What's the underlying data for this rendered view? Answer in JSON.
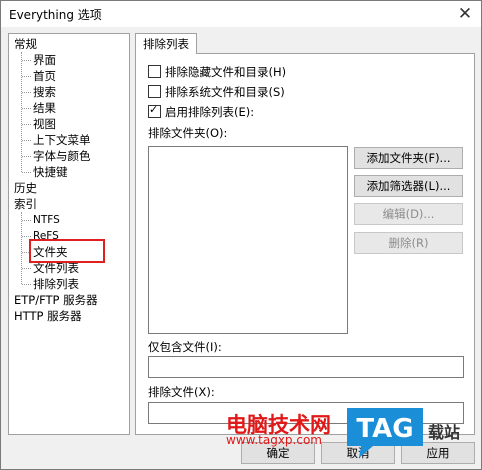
{
  "window": {
    "title": "Everything 选项"
  },
  "tree": {
    "items": [
      {
        "label": "常规"
      },
      {
        "label": "界面"
      },
      {
        "label": "首页"
      },
      {
        "label": "搜索"
      },
      {
        "label": "结果"
      },
      {
        "label": "视图"
      },
      {
        "label": "上下文菜单"
      },
      {
        "label": "字体与颜色"
      },
      {
        "label": "快捷键"
      },
      {
        "label": "历史"
      },
      {
        "label": "索引"
      },
      {
        "label": "NTFS"
      },
      {
        "label": "ReFS"
      },
      {
        "label": "文件夹"
      },
      {
        "label": "文件列表"
      },
      {
        "label": "排除列表"
      },
      {
        "label": "ETP/FTP 服务器"
      },
      {
        "label": "HTTP 服务器"
      }
    ]
  },
  "tab": {
    "label": "排除列表"
  },
  "panel": {
    "exclude_hidden": {
      "label": "排除隐藏文件和目录(H)",
      "checked": false
    },
    "exclude_system": {
      "label": "排除系统文件和目录(S)",
      "checked": false
    },
    "enable_exclude": {
      "label": "启用排除列表(E):",
      "checked": true
    },
    "folders_label": "排除文件夹(O):",
    "add_folder_button": "添加文件夹(F)...",
    "add_filter_button": "添加筛选器(L)...",
    "edit_button": "编辑(D)...",
    "delete_button": "删除(R)",
    "include_only_label": "仅包含文件(I):",
    "exclude_files_label": "排除文件(X):"
  },
  "bottom": {
    "ok_button": "确定",
    "cancel_button": "取消",
    "apply_button": "应用"
  },
  "watermark": {
    "text": "电脑技术网",
    "url": "www.tagxp.com",
    "logo": "TAG",
    "side_text": "载站"
  },
  "colors": {
    "highlight": "#e02020",
    "watermark_red": "#e01818",
    "logo_blue": "#1a8fd8"
  }
}
